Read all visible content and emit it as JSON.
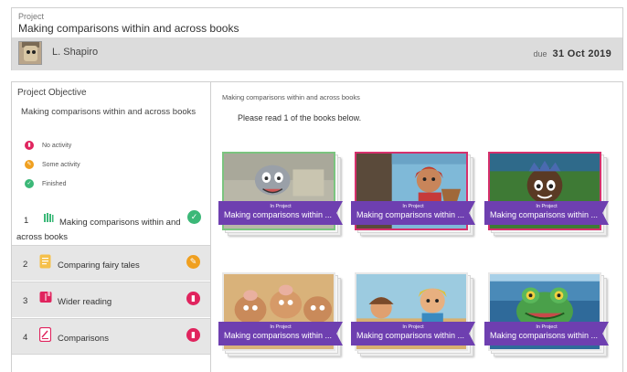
{
  "header": {
    "project_label": "Project",
    "project_title": "Making comparisons within and across books",
    "user_name": "L. Shapiro",
    "due_prefix": "due",
    "due_date": "31 Oct 2019"
  },
  "left": {
    "objective_label": "Project Objective",
    "objective_text": "Making comparisons within and across books",
    "legend": [
      {
        "label": "No activity",
        "color": "#e0245e",
        "icon": "minus-icon"
      },
      {
        "label": "Some activity",
        "color": "#f0a020",
        "icon": "pencil-icon"
      },
      {
        "label": "Finished",
        "color": "#3cb878",
        "icon": "check-icon"
      }
    ],
    "steps": [
      {
        "num": "1",
        "label": "Making comparisons within and across books",
        "icon": "bookshelf-icon",
        "icon_color": "#3cb878",
        "status": "finished",
        "status_color": "#3cb878",
        "status_glyph": "✓"
      },
      {
        "num": "2",
        "label": "Comparing fairy tales",
        "icon": "book-icon",
        "icon_color": "#f5c04a",
        "status": "some activity",
        "status_color": "#f0a020",
        "status_glyph": "✎"
      },
      {
        "num": "3",
        "label": "Wider reading",
        "icon": "book-icon",
        "icon_color": "#e0245e",
        "status": "no activity",
        "status_color": "#e0245e",
        "status_glyph": "▮"
      },
      {
        "num": "4",
        "label": "Comparisons",
        "icon": "clipboard-icon",
        "icon_color": "#e0245e",
        "status": "no activity",
        "status_color": "#e0245e",
        "status_glyph": "▮"
      }
    ]
  },
  "right": {
    "title": "Making comparisons within and across books",
    "instruction": "Please read 1 of the books below.",
    "books": [
      {
        "status": "In Project",
        "title": "Making comparisons within ...",
        "border": "#7bc47f"
      },
      {
        "status": "In Project",
        "title": "Making comparisons within ...",
        "border": "#d6306c"
      },
      {
        "status": "In Project",
        "title": "Making comparisons within ...",
        "border": "#d6306c"
      },
      {
        "status": "In Project",
        "title": "Making comparisons within ...",
        "border": "#e8e8e8"
      },
      {
        "status": "In Project",
        "title": "Making comparisons within ...",
        "border": "#e8e8e8"
      },
      {
        "status": "In Project",
        "title": "Making comparisons within ...",
        "border": "#e8e8e8"
      }
    ]
  }
}
